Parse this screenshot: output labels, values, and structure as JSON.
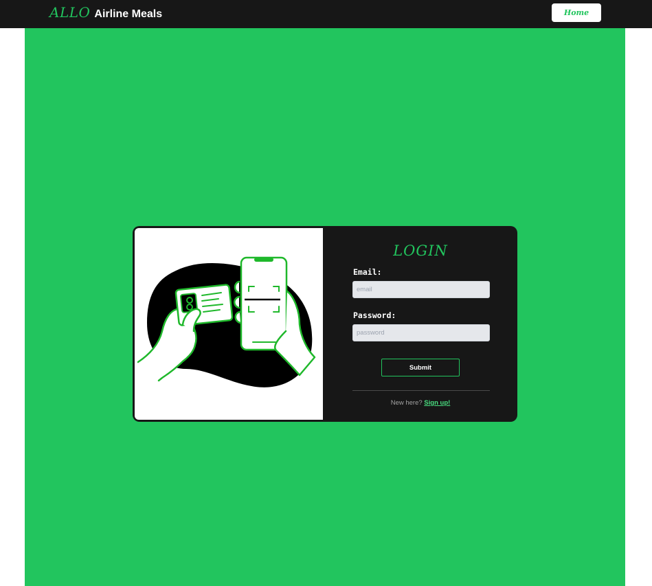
{
  "navbar": {
    "brand_allo": "ALLO",
    "brand_name": "Airline Meals",
    "home_label": "Home"
  },
  "login": {
    "title": "LOGIN",
    "email_label": "Email:",
    "email_placeholder": "email",
    "email_value": "",
    "password_label": "Password:",
    "password_placeholder": "password",
    "password_value": "",
    "submit_label": "Submit",
    "signup_prompt": "New here?",
    "signup_link": "Sign up!"
  },
  "illustration": {
    "icon": "hands-id-card-phone-scan-illustration"
  },
  "colors": {
    "accent": "#22c55e",
    "dark": "#171717",
    "input_bg": "#e5e7eb",
    "link": "#4ade80"
  }
}
